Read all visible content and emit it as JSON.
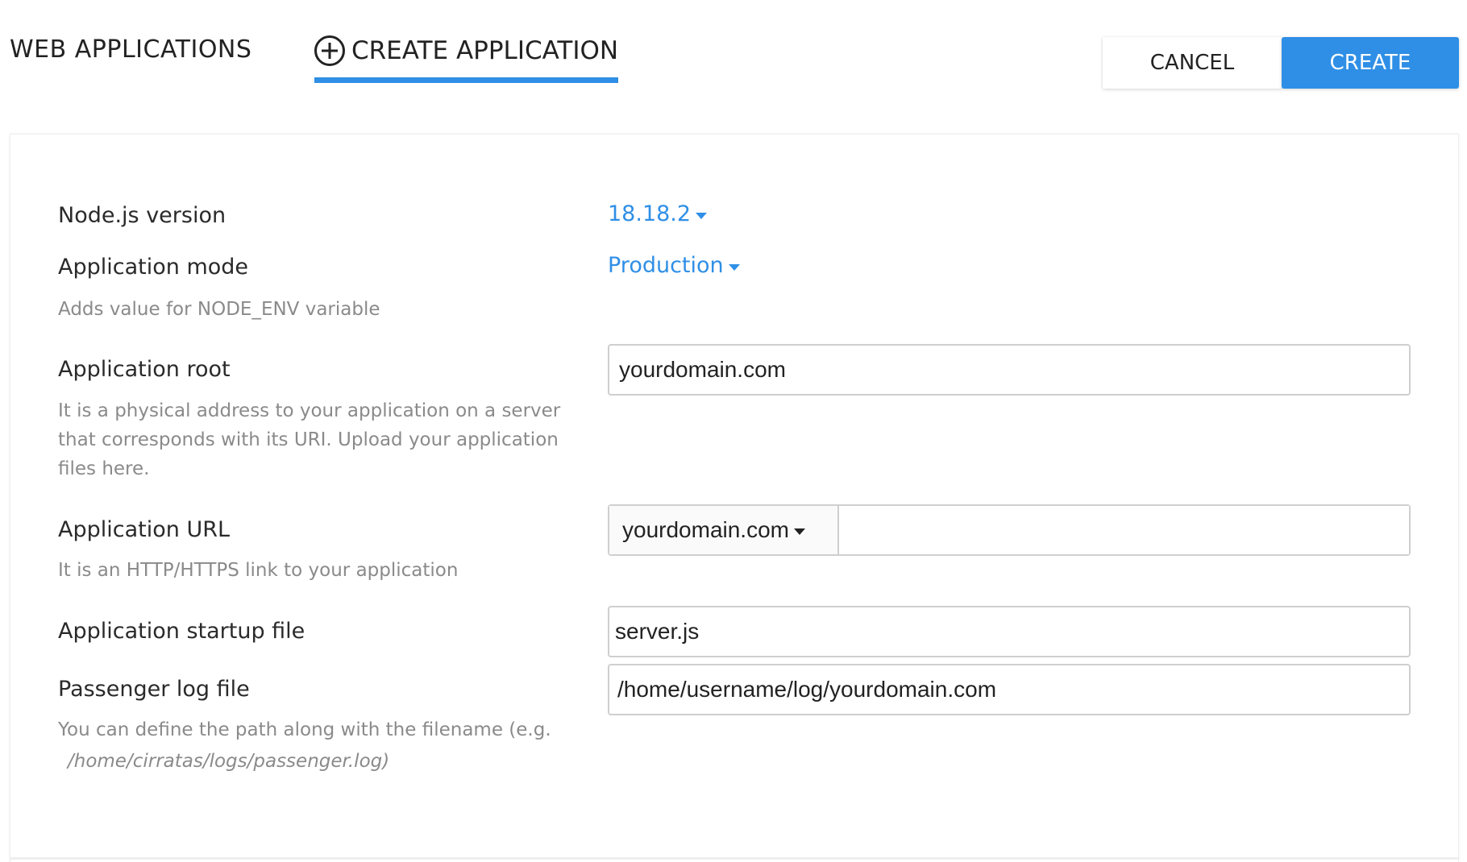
{
  "header": {
    "tab_web_applications": "WEB APPLICATIONS",
    "tab_create_application": "CREATE APPLICATION",
    "cancel_label": "CANCEL",
    "create_label": "CREATE"
  },
  "form": {
    "nodejs_version": {
      "label": "Node.js version",
      "value": "18.18.2"
    },
    "app_mode": {
      "label": "Application mode",
      "value": "Production",
      "hint": "Adds value for NODE_ENV variable"
    },
    "app_root": {
      "label": "Application root",
      "value": "yourdomain.com",
      "hint": "It is a physical address to your application on a server that corresponds with its URI. Upload your application files here."
    },
    "app_url": {
      "label": "Application URL",
      "domain": "yourdomain.com",
      "path": "",
      "hint": "It is an HTTP/HTTPS link to your application"
    },
    "startup_file": {
      "label": "Application startup file",
      "value": "server.js"
    },
    "passenger_log": {
      "label": "Passenger log file",
      "value": "/home/username/log/yourdomain.com",
      "hint": "You can define the path along with the filename (e.g.",
      "hint_example": "/home/cirratas/logs/passenger.log)"
    }
  },
  "colors": {
    "accent": "#2f8fe6",
    "text": "#2a2a2a",
    "hint": "#8a8a8a",
    "border": "#cfcfcf"
  }
}
